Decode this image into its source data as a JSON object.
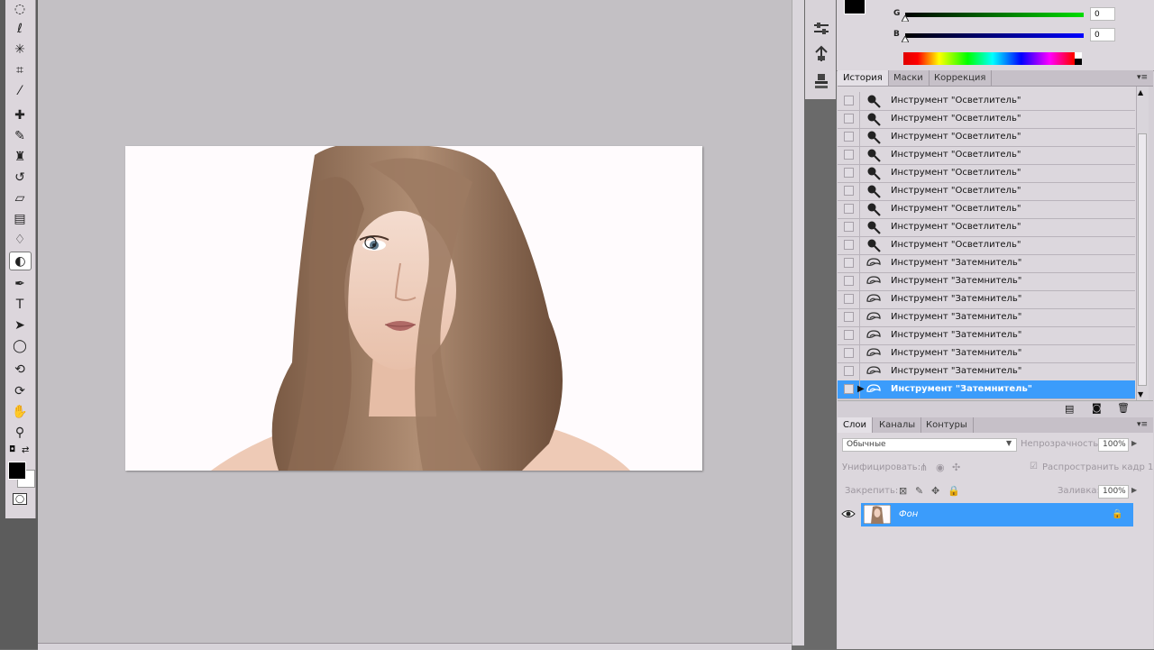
{
  "color_panel": {
    "channels": [
      {
        "label": "G",
        "value": "0",
        "color": "#00cc00"
      },
      {
        "label": "B",
        "value": "0",
        "color": "#0000ff"
      }
    ]
  },
  "history_panel": {
    "tabs": [
      "История",
      "Маски",
      "Коррекция"
    ],
    "items": [
      {
        "label": "Инструмент \"Осветлитель\"",
        "icon": "dodge-icon"
      },
      {
        "label": "Инструмент \"Осветлитель\"",
        "icon": "dodge-icon"
      },
      {
        "label": "Инструмент \"Осветлитель\"",
        "icon": "dodge-icon"
      },
      {
        "label": "Инструмент \"Осветлитель\"",
        "icon": "dodge-icon"
      },
      {
        "label": "Инструмент \"Осветлитель\"",
        "icon": "dodge-icon"
      },
      {
        "label": "Инструмент \"Осветлитель\"",
        "icon": "dodge-icon"
      },
      {
        "label": "Инструмент \"Осветлитель\"",
        "icon": "dodge-icon"
      },
      {
        "label": "Инструмент \"Осветлитель\"",
        "icon": "dodge-icon"
      },
      {
        "label": "Инструмент \"Осветлитель\"",
        "icon": "dodge-icon"
      },
      {
        "label": "Инструмент \"Затемнитель\"",
        "icon": "burn-icon"
      },
      {
        "label": "Инструмент \"Затемнитель\"",
        "icon": "burn-icon"
      },
      {
        "label": "Инструмент \"Затемнитель\"",
        "icon": "burn-icon"
      },
      {
        "label": "Инструмент \"Затемнитель\"",
        "icon": "burn-icon"
      },
      {
        "label": "Инструмент \"Затемнитель\"",
        "icon": "burn-icon"
      },
      {
        "label": "Инструмент \"Затемнитель\"",
        "icon": "burn-icon"
      },
      {
        "label": "Инструмент \"Затемнитель\"",
        "icon": "burn-icon"
      },
      {
        "label": "Инструмент \"Затемнитель\"",
        "icon": "burn-icon",
        "selected": true
      }
    ]
  },
  "layers_panel": {
    "tabs": [
      "Слои",
      "Каналы",
      "Контуры"
    ],
    "blend_mode": "Обычные",
    "opacity_label": "Непрозрачность:",
    "opacity_value": "100%",
    "unify_label": "Унифицировать:",
    "propagate_label": "Распространить кадр 1",
    "lock_label": "Закрепить:",
    "fill_label": "Заливка:",
    "fill_value": "100%",
    "layers": [
      {
        "name": "Фон",
        "visible": true,
        "locked": true,
        "selected": true
      }
    ]
  },
  "tools": [
    "marquee-tool-icon",
    "lasso-tool-icon",
    "quick-selection-tool-icon",
    "crop-tool-icon",
    "eyedropper-tool-icon",
    "healing-brush-tool-icon",
    "brush-tool-icon",
    "clone-stamp-tool-icon",
    "history-brush-tool-icon",
    "eraser-tool-icon",
    "gradient-tool-icon",
    "blur-tool-icon",
    "dodge-burn-tool-icon",
    "pen-tool-icon",
    "type-tool-icon",
    "path-selection-tool-icon",
    "ellipse-tool-icon",
    "3d-rotate-tool-icon",
    "3d-orbit-tool-icon",
    "hand-tool-icon",
    "zoom-tool-icon"
  ],
  "accent_color": "#3b9cfb"
}
